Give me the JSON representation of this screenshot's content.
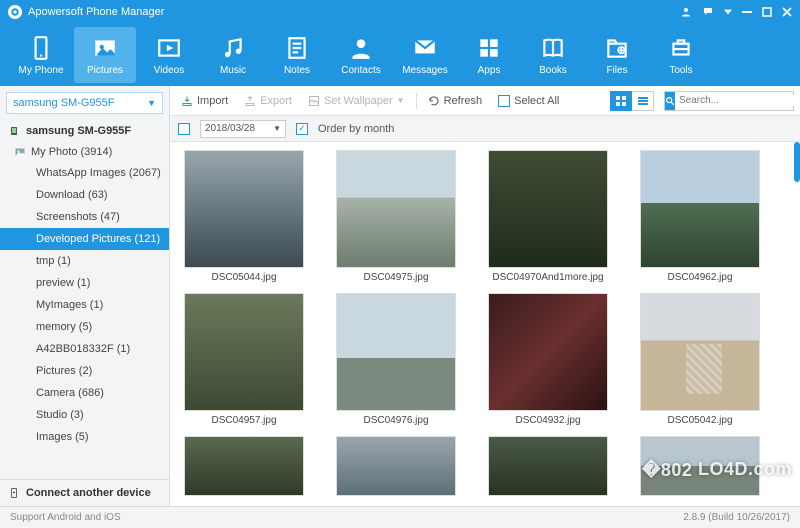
{
  "titlebar": {
    "title": "Apowersoft Phone Manager"
  },
  "nav": [
    {
      "key": "myphone",
      "label": "My Phone"
    },
    {
      "key": "pictures",
      "label": "Pictures"
    },
    {
      "key": "videos",
      "label": "Videos"
    },
    {
      "key": "music",
      "label": "Music"
    },
    {
      "key": "notes",
      "label": "Notes"
    },
    {
      "key": "contacts",
      "label": "Contacts"
    },
    {
      "key": "messages",
      "label": "Messages"
    },
    {
      "key": "apps",
      "label": "Apps"
    },
    {
      "key": "books",
      "label": "Books"
    },
    {
      "key": "files",
      "label": "Files"
    },
    {
      "key": "tools",
      "label": "Tools"
    }
  ],
  "nav_active": "pictures",
  "sidebar": {
    "device_selected": "samsung SM-G955F",
    "device_header": "samsung SM-G955F",
    "root": {
      "label": "My Photo",
      "count": 3914
    },
    "items": [
      {
        "label": "WhatsApp Images",
        "count": 2067
      },
      {
        "label": "Download",
        "count": 63
      },
      {
        "label": "Screenshots",
        "count": 47
      },
      {
        "label": "Developed Pictures",
        "count": 121
      },
      {
        "label": "tmp",
        "count": 1
      },
      {
        "label": "preview",
        "count": 1
      },
      {
        "label": "MyImages",
        "count": 1
      },
      {
        "label": "memory",
        "count": 5
      },
      {
        "label": "A42BB018332F",
        "count": 1
      },
      {
        "label": "Pictures",
        "count": 2
      },
      {
        "label": "Camera",
        "count": 686
      },
      {
        "label": "Studio",
        "count": 3
      },
      {
        "label": "Images",
        "count": 5
      }
    ],
    "selected_index": 3,
    "connect_another": "Connect another device"
  },
  "toolbar": {
    "import": "Import",
    "export": "Export",
    "set_wallpaper": "Set Wallpaper",
    "refresh": "Refresh",
    "select_all": "Select All",
    "search_placeholder": "Search..."
  },
  "filter": {
    "date": "2018/03/28",
    "order_by_month": "Order by month"
  },
  "thumbs": [
    {
      "file": "DSC05044.jpg",
      "cls": "ph1"
    },
    {
      "file": "DSC04975.jpg",
      "cls": "ph2"
    },
    {
      "file": "DSC04970And1more.jpg",
      "cls": "ph3"
    },
    {
      "file": "DSC04962.jpg",
      "cls": "ph4"
    },
    {
      "file": "DSC04957.jpg",
      "cls": "ph5"
    },
    {
      "file": "DSC04976.jpg",
      "cls": "ph6"
    },
    {
      "file": "DSC04932.jpg",
      "cls": "ph7"
    },
    {
      "file": "DSC05042.jpg",
      "cls": "ph8"
    },
    {
      "file": "",
      "cls": "ph9"
    },
    {
      "file": "",
      "cls": "ph10"
    },
    {
      "file": "",
      "cls": "ph11"
    },
    {
      "file": "",
      "cls": "ph12"
    }
  ],
  "footer": {
    "left": "Support Android and iOS",
    "right": "2.8.9 (Build 10/26/2017)"
  },
  "watermark": "LO4D.com"
}
